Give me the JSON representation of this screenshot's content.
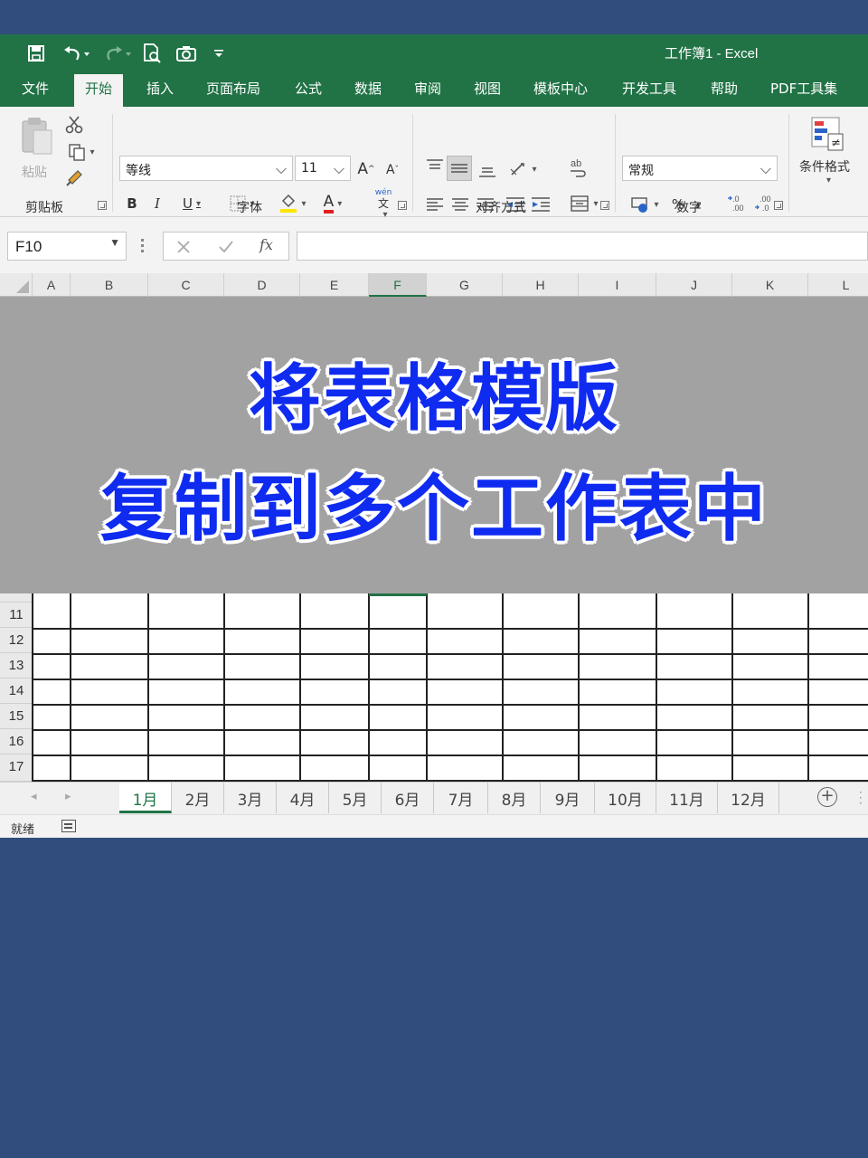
{
  "titlebar": {
    "title": "工作簿1 - Excel",
    "qat_icons": [
      "save-icon",
      "undo-icon",
      "redo-icon",
      "print-preview-icon",
      "camera-icon",
      "customize-qat-icon"
    ]
  },
  "ribbon_tabs": [
    "文件",
    "开始",
    "插入",
    "页面布局",
    "公式",
    "数据",
    "审阅",
    "视图",
    "模板中心",
    "开发工具",
    "帮助",
    "PDF工具集"
  ],
  "active_tab": "开始",
  "clipboard": {
    "label": "剪贴板",
    "paste_label": "粘贴"
  },
  "font": {
    "label": "字体",
    "font_name": "等线",
    "font_size": "11",
    "grow_label": "A",
    "shrink_label": "A",
    "bold": "B",
    "italic": "I",
    "underline": "U",
    "font_color": "A",
    "phonetic_top": "wén",
    "phonetic_bottom": "文"
  },
  "alignment": {
    "label": "对齐方式"
  },
  "number": {
    "label": "数字",
    "format": "常规",
    "percent": "%",
    "comma": "，"
  },
  "styles": {
    "conditional_format_label": "条件格式"
  },
  "formula_bar": {
    "name_box": "F10",
    "fx": "fx",
    "value": ""
  },
  "columns": [
    "A",
    "B",
    "C",
    "D",
    "E",
    "F",
    "G",
    "H",
    "I",
    "J",
    "K",
    "L"
  ],
  "selected_column": "F",
  "banner": {
    "line1": "将表格模版",
    "line2": "复制到多个工作表中"
  },
  "rows": [
    "11",
    "12",
    "13",
    "14",
    "15",
    "16",
    "17"
  ],
  "sheets": [
    "1月",
    "2月",
    "3月",
    "4月",
    "5月",
    "6月",
    "7月",
    "8月",
    "9月",
    "10月",
    "11月",
    "12月"
  ],
  "active_sheet": "1月",
  "status": {
    "text": "就绪"
  },
  "colors": {
    "excel_green": "#217346",
    "background_blue": "#314d7e",
    "banner_gray": "#a2a2a2",
    "banner_text": "#0f2bf0"
  }
}
